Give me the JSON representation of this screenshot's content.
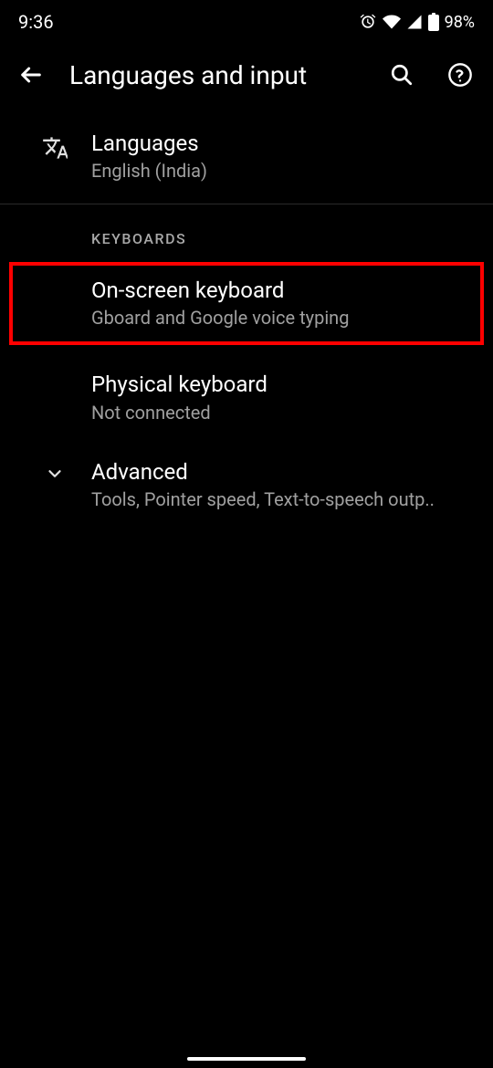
{
  "status_bar": {
    "time": "9:36",
    "battery_text": "98%"
  },
  "app_bar": {
    "title": "Languages and input"
  },
  "languages": {
    "title": "Languages",
    "subtitle": "English (India)"
  },
  "section_keyboards": {
    "header": "KEYBOARDS",
    "onscreen": {
      "title": "On-screen keyboard",
      "subtitle": "Gboard and Google voice typing"
    },
    "physical": {
      "title": "Physical keyboard",
      "subtitle": "Not connected"
    }
  },
  "advanced": {
    "title": "Advanced",
    "subtitle": "Tools, Pointer speed, Text-to-speech outp.."
  }
}
